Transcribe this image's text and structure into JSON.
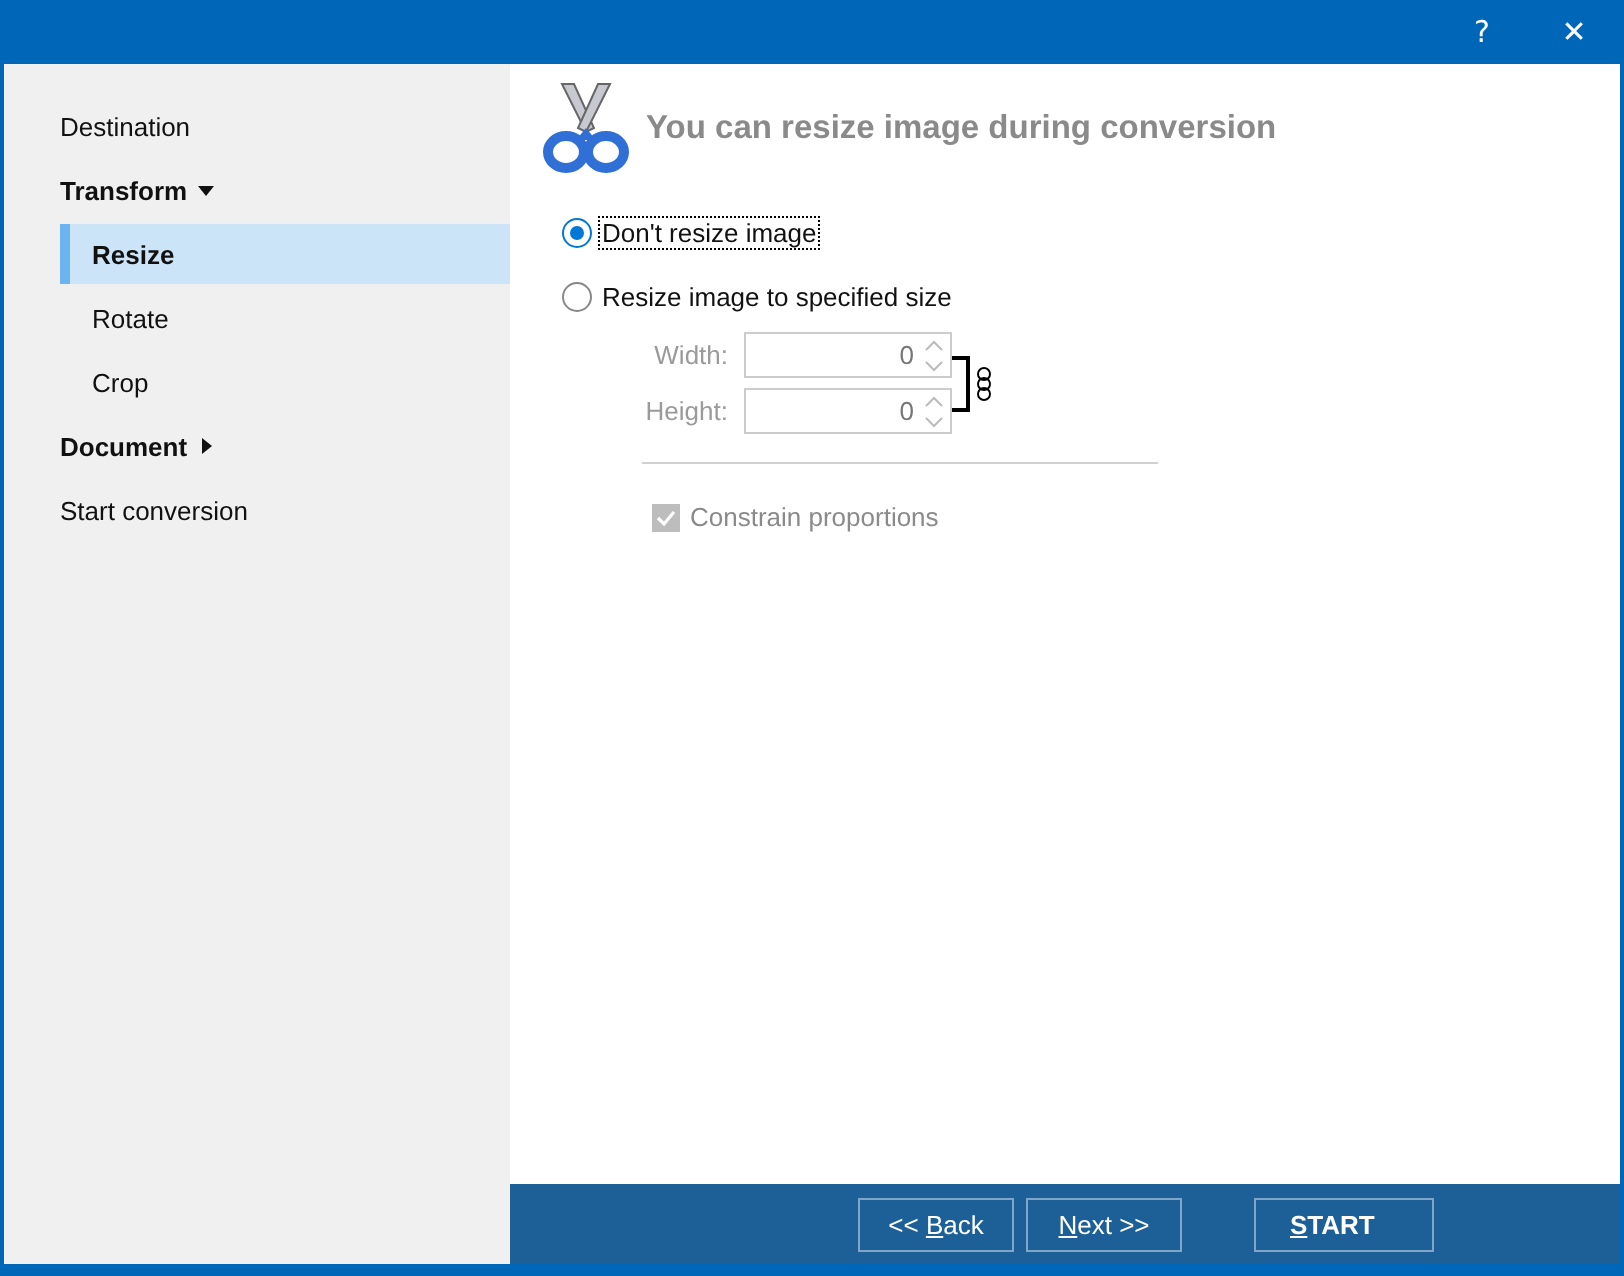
{
  "window": {
    "title_buttons": [
      "?",
      "✕"
    ]
  },
  "sidebar": {
    "items": [
      {
        "label": "Destination",
        "kind": "item",
        "selected": false
      },
      {
        "label": "Transform",
        "kind": "group",
        "expanded": true,
        "children": [
          {
            "label": "Resize",
            "selected": true
          },
          {
            "label": "Rotate",
            "selected": false
          },
          {
            "label": "Crop",
            "selected": false
          }
        ]
      },
      {
        "label": "Document",
        "kind": "group",
        "expanded": false
      },
      {
        "label": "Start conversion",
        "kind": "item",
        "selected": false
      }
    ]
  },
  "page": {
    "title": "You can resize image during conversion",
    "options": [
      {
        "label": "Don't resize image",
        "selected": true,
        "focused": true
      },
      {
        "label": "Resize image to specified size",
        "selected": false,
        "focused": false
      }
    ],
    "size_fields": [
      {
        "label": "Width:",
        "value": "0"
      },
      {
        "label": "Height:",
        "value": "0"
      }
    ],
    "size_fields_disabled": true,
    "constrain": {
      "label": "Constrain proportions",
      "checked": true,
      "disabled": true
    }
  },
  "footer": {
    "buttons": [
      {
        "before": "<< ",
        "key": "B",
        "after": "ack",
        "kind": "nav"
      },
      {
        "key": "N",
        "after": "ext >>",
        "kind": "nav"
      },
      {
        "key": "S",
        "after": "TART",
        "kind": "primary"
      }
    ]
  }
}
